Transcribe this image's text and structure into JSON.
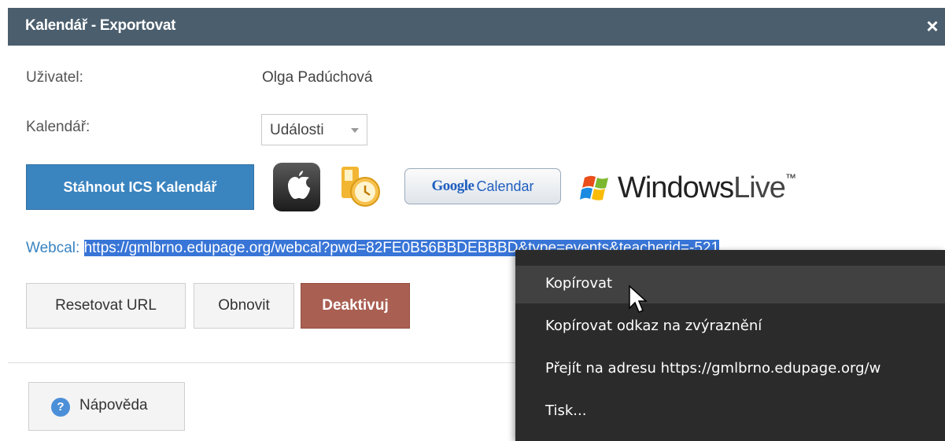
{
  "dialog": {
    "title": "Kalendář - Exportovat",
    "close_icon": "×"
  },
  "form": {
    "user_label": "Uživatel:",
    "user_value": "Olga Padúchová",
    "calendar_label": "Kalendář:",
    "calendar_select_value": "Události"
  },
  "export": {
    "download_button": "Stáhnout ICS Kalendář",
    "icons": [
      "apple-icon",
      "outlook-icon",
      "google-calendar-icon",
      "windows-live-icon"
    ],
    "google_brand": "Google",
    "google_calendar": "Calendar",
    "windows_live_brand": "Windows",
    "windows_live_suffix": "Live",
    "windows_live_tm": "™"
  },
  "webcal": {
    "label": "Webcal:",
    "url": "https://gmlbrno.edupage.org/webcal?pwd=82FE0B56BBDEBBBD&type=events&teacherid=-521"
  },
  "actions": {
    "reset_url": "Resetovat URL",
    "refresh": "Obnovit",
    "deactivate": "Deaktivuj"
  },
  "help": {
    "icon": "?",
    "label": "Nápověda"
  },
  "context_menu": {
    "items": [
      "Kopírovat",
      "Kopírovat odkaz na zvýraznění",
      "Přejít na adresu https://gmlbrno.edupage.org/w",
      "Tisk..."
    ],
    "hovered_index": 0
  },
  "colors": {
    "titlebar": "#4b5e6d",
    "primary_button": "#3a84c0",
    "danger_button": "#a95f52",
    "selection": "#3875d7",
    "context_menu_bg": "#2b2b2b"
  }
}
